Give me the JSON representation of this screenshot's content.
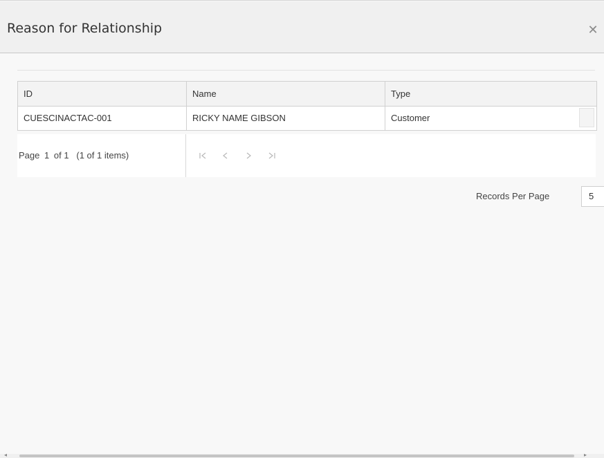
{
  "dialog": {
    "title": "Reason for Relationship",
    "close_icon": "close-icon"
  },
  "grid": {
    "columns": [
      "ID",
      "Name",
      "Type"
    ],
    "rows": [
      {
        "id": "CUESCINACTAC-001",
        "name": "RICKY NAME GIBSON",
        "type": "Customer"
      }
    ]
  },
  "pager": {
    "page_label": "Page",
    "current_page": "1",
    "of_label": "of 1",
    "items_label": "(1 of 1 items)",
    "nav_icons": [
      "first-page-icon",
      "previous-page-icon",
      "next-page-icon",
      "last-page-icon"
    ]
  },
  "records_per_page": {
    "label": "Records Per Page",
    "value": "5"
  }
}
